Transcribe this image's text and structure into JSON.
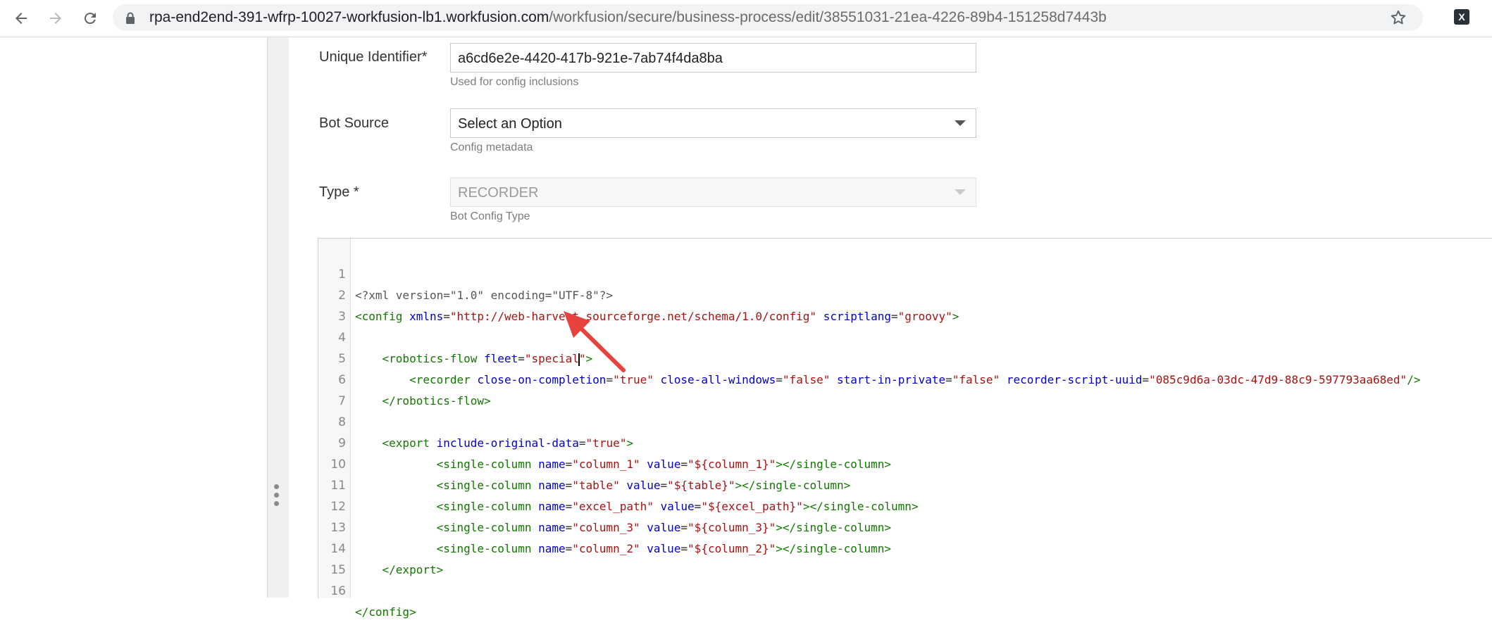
{
  "browser": {
    "url_host": "rpa-end2end-391-wfrp-10027-workfusion-lb1.workfusion.com",
    "url_path": "/workfusion/secure/business-process/edit/38551031-21ea-4226-89b4-151258d7443b",
    "extension_letter": "X"
  },
  "form": {
    "unique_identifier": {
      "label": "Unique Identifier*",
      "value": "a6cd6e2e-4420-417b-921e-7ab74f4da8ba",
      "hint": "Used for config inclusions"
    },
    "bot_source": {
      "label": "Bot Source",
      "selected": "Select an Option",
      "hint": "Config metadata"
    },
    "type": {
      "label": "Type *",
      "selected": "RECORDER",
      "hint": "Bot Config Type"
    }
  },
  "editor": {
    "line_numbers": [
      "1",
      "2",
      "3",
      "4",
      "5",
      "6",
      "7",
      "8",
      "9",
      "10",
      "11",
      "12",
      "13",
      "14",
      "15",
      "16"
    ],
    "line1": {
      "pi": "<?xml version=\"1.0\" encoding=\"UTF-8\"?>"
    },
    "line2": {
      "t1": "<config",
      "a1": "xmlns",
      "v1": "\"http://web-harvest.sourceforge.net/schema/1.0/config\"",
      "a2": "scriptlang",
      "v2": "\"groovy\"",
      "t2": ">"
    },
    "line4": {
      "t1": "<robotics-flow",
      "a1": "fleet",
      "v1a": "\"special",
      "v1b": "\"",
      "t2": ">"
    },
    "line5": {
      "t1": "<recorder",
      "a1": "close-on-completion",
      "v1": "\"true\"",
      "a2": "close-all-windows",
      "v2": "\"false\"",
      "a3": "start-in-private",
      "v3": "\"false\"",
      "a4": "recorder-script-uuid",
      "v4": "\"085c9d6a-03dc-47d9-88c9-597793aa68ed\"",
      "t2": "/>"
    },
    "line6": {
      "t1": "</robotics-flow>"
    },
    "line8": {
      "t1": "<export",
      "a1": "include-original-data",
      "v1": "\"true\"",
      "t2": ">"
    },
    "columns": [
      {
        "t1": "<single-column",
        "a1": "name",
        "v1": "\"column_1\"",
        "a2": "value",
        "v2": "\"${column_1}\"",
        "t2": "></single-column>"
      },
      {
        "t1": "<single-column",
        "a1": "name",
        "v1": "\"table\"",
        "a2": "value",
        "v2": "\"${table}\"",
        "t2": "></single-column>"
      },
      {
        "t1": "<single-column",
        "a1": "name",
        "v1": "\"excel_path\"",
        "a2": "value",
        "v2": "\"${excel_path}\"",
        "t2": "></single-column>"
      },
      {
        "t1": "<single-column",
        "a1": "name",
        "v1": "\"column_3\"",
        "a2": "value",
        "v2": "\"${column_3}\"",
        "t2": "></single-column>"
      },
      {
        "t1": "<single-column",
        "a1": "name",
        "v1": "\"column_2\"",
        "a2": "value",
        "v2": "\"${column_2}\"",
        "t2": "></single-column>"
      }
    ],
    "line14": {
      "t1": "</export>"
    },
    "line16": {
      "t1": "</config>"
    }
  },
  "colors": {
    "tag": "#117700",
    "attribute": "#0000cc",
    "string": "#aa1111",
    "annotation_arrow": "#e8423f"
  }
}
